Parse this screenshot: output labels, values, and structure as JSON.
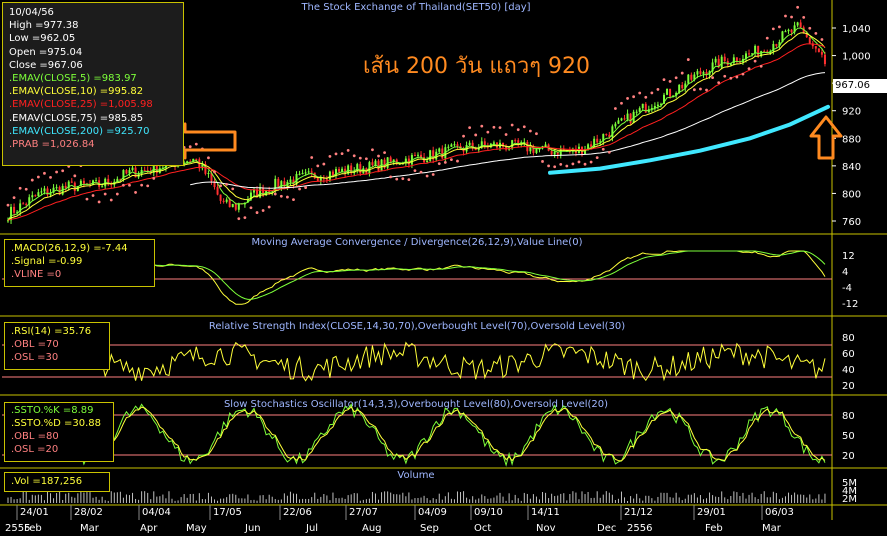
{
  "price_panel": {
    "title": "The Stock Exchange of Thailand(SET50) [day]",
    "annotation": "เส้น 200 วัน แถวๆ 920",
    "last_value_label": "967.06",
    "info_lines": [
      {
        "text": "10/04/56",
        "color": "#ffffff"
      },
      {
        "text": "High  =977.38",
        "color": "#ffffff"
      },
      {
        "text": "Low  =962.05",
        "color": "#ffffff"
      },
      {
        "text": "Open  =975.04",
        "color": "#ffffff"
      },
      {
        "text": "Close  =967.06",
        "color": "#ffffff"
      },
      {
        "text": ".EMAV(CLOSE,5)  =983.97",
        "color": "#7dff3a"
      },
      {
        "text": ".EMAV(CLOSE,10)  =995.82",
        "color": "#ffff3a"
      },
      {
        "text": ".EMAV(CLOSE,25)  =1,005.98",
        "color": "#ff2020"
      },
      {
        "text": ".EMAV(CLOSE,75)  =985.85",
        "color": "#ffffff"
      },
      {
        "text": ".EMAV(CLOSE,200)  =925.70",
        "color": "#40e8ff"
      },
      {
        "text": ".PRAB  =1,026.84",
        "color": "#ff8080"
      }
    ],
    "y_ticks": [
      "1,040",
      "1,000",
      "960",
      "920",
      "880",
      "840",
      "800",
      "760"
    ]
  },
  "macd_panel": {
    "title": "Moving Average Convergence / Divergence(26,12,9),Value Line(0)",
    "legend": [
      {
        "text": ".MACD(26,12,9)  =-7.44",
        "color": "#ffff3a"
      },
      {
        "text": ".Signal  =-0.99",
        "color": "#ffff3a"
      },
      {
        "text": ".VLINE  =0",
        "color": "#ff8080"
      }
    ],
    "y_ticks": [
      "12",
      "4",
      "-4",
      "-12"
    ]
  },
  "rsi_panel": {
    "title": "Relative Strength Index(CLOSE,14,30,70),Overbought Level(70),Oversold Level(30)",
    "legend": [
      {
        "text": ".RSI(14)  =35.76",
        "color": "#ffff3a"
      },
      {
        "text": ".OBL  =70",
        "color": "#ff8080"
      },
      {
        "text": ".OSL  =30",
        "color": "#ff8080"
      }
    ],
    "y_ticks": [
      "80",
      "60",
      "40",
      "20"
    ]
  },
  "sto_panel": {
    "title": "Slow Stochastics Oscillator(14,3,3),Overbought Level(80),Oversold Level(20)",
    "legend": [
      {
        "text": ".SSTO.%K  =8.89",
        "color": "#7dff3a"
      },
      {
        "text": ".SSTO.%D  =30.88",
        "color": "#ffff3a"
      },
      {
        "text": ".OBL  =80",
        "color": "#ff8080"
      },
      {
        "text": ".OSL  =20",
        "color": "#ff8080"
      }
    ],
    "y_ticks": [
      "80",
      "50",
      "20"
    ]
  },
  "vol_panel": {
    "title": "Volume",
    "legend": [
      {
        "text": ".Vol  =187,256",
        "color": "#ffff3a"
      }
    ],
    "y_ticks": [
      "5M",
      "4M",
      "2M"
    ]
  },
  "x_axis": {
    "ticks_top": [
      "24/01",
      "28/02",
      "04/04",
      "17/05",
      "22/06",
      "27/07",
      "04/09",
      "09/10",
      "14/11",
      "21/12",
      "29/01",
      "06/03"
    ],
    "ticks_bottom": [
      "2555",
      "Feb",
      "Mar",
      "Apr",
      "May",
      "Jun",
      "Jul",
      "Aug",
      "Sep",
      "Oct",
      "Nov",
      "Dec",
      "2556",
      "Feb",
      "Mar"
    ]
  },
  "colors": {
    "ema5": "#7dff3a",
    "ema10": "#ffff3a",
    "ema25": "#ff2020",
    "ema75": "#ffffff",
    "ema200": "#40e8ff",
    "prab": "#ff8080",
    "panel_border": "#c9c200",
    "level_line": "#ff8080",
    "annotation": "#ff8a20"
  },
  "chart_data": {
    "type": "line",
    "title": "The Stock Exchange of Thailand(SET50) [day]",
    "ylim": [
      740,
      1060
    ],
    "series": [
      {
        "name": "Close",
        "x": [
          "24/01",
          "28/02",
          "04/04",
          "17/05",
          "22/06",
          "27/07",
          "04/09",
          "09/10",
          "14/11",
          "21/12",
          "29/01",
          "06/03",
          "10/04"
        ],
        "values": [
          790,
          815,
          850,
          775,
          815,
          835,
          860,
          870,
          860,
          920,
          995,
          1040,
          967
        ]
      },
      {
        "name": ".EMAV(CLOSE,200)",
        "x": [
          "14/11",
          "21/12",
          "29/01",
          "06/03",
          "10/04"
        ],
        "values": [
          830,
          845,
          875,
          905,
          925.7
        ]
      }
    ]
  }
}
